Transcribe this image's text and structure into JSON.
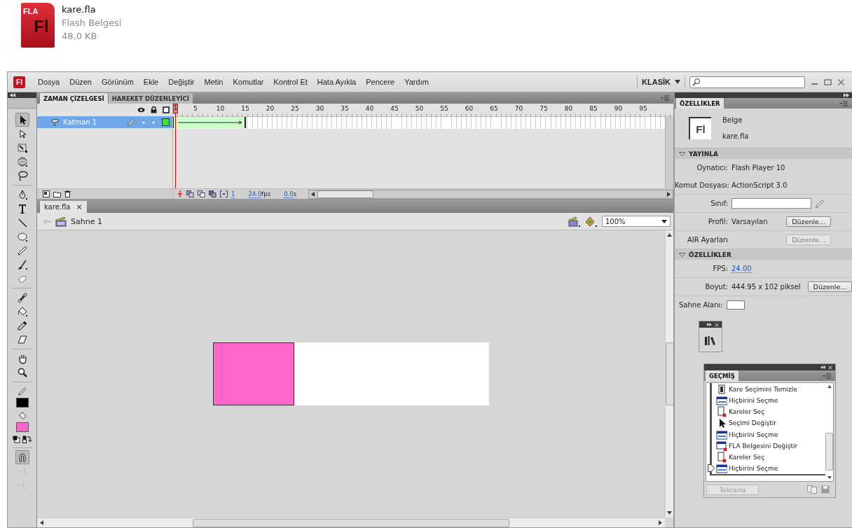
{
  "file_icon": {
    "badge": "FLA",
    "logo": "Fl",
    "name": "kare.fla",
    "type": "Flash Belgesi",
    "size": "48,0 KB"
  },
  "app": {
    "logo": "Fl",
    "menu": [
      "Dosya",
      "Düzen",
      "Görünüm",
      "Ekle",
      "Değiştir",
      "Metin",
      "Komutlar",
      "Kontrol Et",
      "Hata Ayıkla",
      "Pencere",
      "Yardım"
    ],
    "workspace": "KLASİK"
  },
  "tool_groups": [
    [
      {
        "kind": "arrow",
        "selected": true
      },
      {
        "kind": "subselect",
        "selected": false
      },
      {
        "kind": "transform",
        "selected": false
      },
      {
        "kind": "sphere",
        "selected": false
      },
      {
        "kind": "lasso",
        "selected": false
      }
    ],
    [
      {
        "kind": "pen",
        "selected": false
      },
      {
        "kind": "text",
        "selected": false
      },
      {
        "kind": "line",
        "selected": false
      },
      {
        "kind": "oval",
        "selected": false
      },
      {
        "kind": "pencil",
        "selected": false
      },
      {
        "kind": "brush",
        "selected": false
      },
      {
        "kind": "deco",
        "selected": false
      }
    ],
    [
      {
        "kind": "bone",
        "selected": false
      },
      {
        "kind": "bucket",
        "selected": false
      },
      {
        "kind": "eyedropper",
        "selected": false
      },
      {
        "kind": "eraser",
        "selected": false
      }
    ],
    [
      {
        "kind": "hand",
        "selected": false
      },
      {
        "kind": "zoom",
        "selected": false
      }
    ]
  ],
  "tool_options": [
    {
      "kind": "snap",
      "selected": true,
      "disabled": false
    },
    {
      "kind": "smooth",
      "selected": false,
      "disabled": true
    },
    {
      "kind": "straighten",
      "selected": false,
      "disabled": true
    }
  ],
  "timeline": {
    "tabs": [
      {
        "label": "ZAMAN ÇİZELGESİ",
        "selected": true
      },
      {
        "label": "HAREKET DÜZENLEYİCİ",
        "selected": false
      }
    ],
    "ruler": [
      "1",
      "5",
      "10",
      "15",
      "20",
      "25",
      "30",
      "35",
      "40",
      "45",
      "50",
      "55",
      "60",
      "65",
      "70",
      "75",
      "80",
      "85",
      "90",
      "95"
    ],
    "layers": [
      {
        "name": "Katman 1",
        "selected": true,
        "color": "#44dd44"
      }
    ],
    "current_frame": "1",
    "fps": "24.0",
    "fps_unit": "fps",
    "time": "0.0",
    "time_unit": "s"
  },
  "document_tabs": [
    {
      "label": "kare.fla",
      "close": "×",
      "selected": true
    }
  ],
  "stage_bar": {
    "scene": "Sahne 1",
    "zoom": "100%"
  },
  "properties": {
    "tab": "ÖZELLİKLER",
    "doc_logo": "Fl",
    "doc_type": "Belge",
    "doc_name": "kare.fla",
    "sections": [
      {
        "title": "YAYINLA",
        "expanded": true,
        "rows": [
          {
            "kind": "text",
            "label": "Oynatıcı:",
            "value": "Flash Player 10"
          },
          {
            "kind": "text",
            "label": "Komut Dosyası:",
            "value": "ActionScript 3.0"
          },
          {
            "kind": "input",
            "label": "Sınıf:"
          },
          {
            "kind": "button",
            "label": "Profil:",
            "value": "Varsayılan",
            "button": "Düzenle...",
            "disabled": false
          },
          {
            "kind": "button",
            "label": "AIR Ayarları",
            "button": "Düzenle...",
            "disabled": true
          }
        ]
      },
      {
        "title": "ÖZELLİKLER",
        "expanded": true,
        "rows": [
          {
            "kind": "link",
            "label": "FPS:",
            "value": "24.00"
          },
          {
            "kind": "button",
            "label": "Boyut:",
            "value": "444.95 x 102 piksel",
            "button": "Düzenle...",
            "disabled": false
          },
          {
            "kind": "color",
            "label": "Sahne Alanı:",
            "color": "#ffffff"
          }
        ]
      }
    ]
  },
  "history": {
    "tab": "GEÇMİŞ",
    "items": [
      {
        "kind": "frame",
        "label": "Kare Seçimini Temizle",
        "selected": false
      },
      {
        "kind": "window",
        "label": "Hiçbirini Seçme",
        "selected": false
      },
      {
        "kind": "frame-x",
        "label": "Kareler Seç",
        "selected": false
      },
      {
        "kind": "arrow",
        "label": "Seçimi Değiştir",
        "selected": false
      },
      {
        "kind": "window",
        "label": "Hiçbirini Seçme",
        "selected": false
      },
      {
        "kind": "window-x",
        "label": "FLA Belgesini Değiştir",
        "selected": false
      },
      {
        "kind": "frame-x",
        "label": "Kareler Seç",
        "selected": false
      },
      {
        "kind": "window",
        "label": "Hiçbirini Seçme",
        "selected": true
      }
    ],
    "replay": {
      "label": "Tekrarla",
      "disabled": true
    }
  }
}
